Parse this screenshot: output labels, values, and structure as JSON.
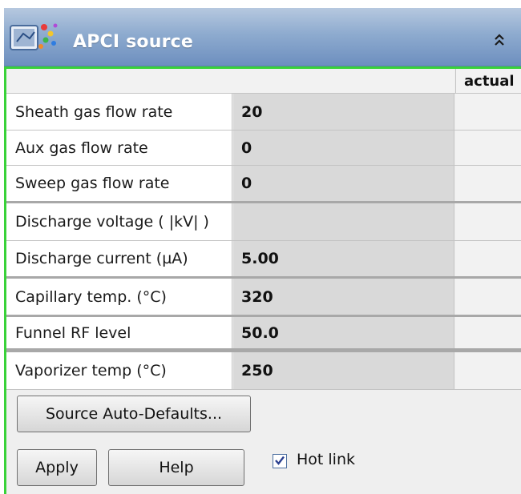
{
  "panel": {
    "title": "APCI source",
    "icon": "apci-source-icon",
    "collapse_icon": "double-chevron-up-icon",
    "accent_color": "#39d239",
    "title_gradient": [
      "#b6c8df",
      "#6d8fbf"
    ]
  },
  "table": {
    "header_actual": "actual",
    "rows": [
      {
        "label": "Sheath gas flow rate",
        "value": "20"
      },
      {
        "label": "Aux gas flow rate",
        "value": "0"
      },
      {
        "label": "Sweep gas flow rate",
        "value": "0"
      },
      {
        "label": "Discharge voltage ( |kV| )",
        "value": ""
      },
      {
        "label": "Discharge current (µA)",
        "value": "5.00"
      },
      {
        "label": "Capillary temp. (°C)",
        "value": "320"
      },
      {
        "label": "Funnel RF level",
        "value": "50.0"
      },
      {
        "label": "Vaporizer temp (°C)",
        "value": "250"
      }
    ]
  },
  "buttons": {
    "auto_defaults": "Source Auto-Defaults...",
    "apply": "Apply",
    "help": "Help"
  },
  "hotlink": {
    "label": "Hot link",
    "checked": true
  }
}
